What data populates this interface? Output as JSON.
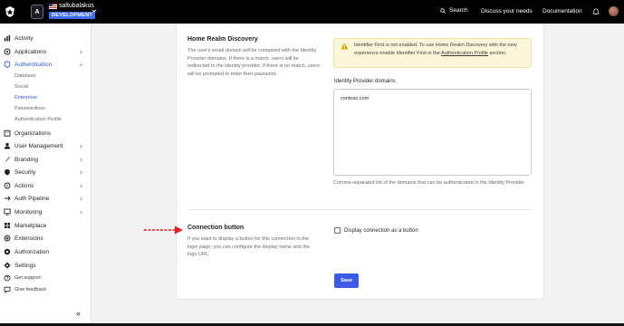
{
  "topbar": {
    "tenant_initial": "A",
    "tenant_name": "saltubalakus",
    "env_badge": "DEVELOPMENT",
    "search_label": "Search",
    "discuss_label": "Discuss your needs",
    "docs_label": "Documentation"
  },
  "sidebar": {
    "items": [
      {
        "label": "Activity",
        "icon": "activity-icon"
      },
      {
        "label": "Applications",
        "icon": "applications-icon"
      },
      {
        "label": "Authentication",
        "icon": "authentication-icon"
      },
      {
        "label": "Organizations",
        "icon": "organizations-icon"
      },
      {
        "label": "User Management",
        "icon": "user-management-icon"
      },
      {
        "label": "Branding",
        "icon": "branding-icon"
      },
      {
        "label": "Security",
        "icon": "security-icon"
      },
      {
        "label": "Actions",
        "icon": "actions-icon"
      },
      {
        "label": "Auth Pipeline",
        "icon": "auth-pipeline-icon"
      },
      {
        "label": "Monitoring",
        "icon": "monitoring-icon"
      },
      {
        "label": "Marketplace",
        "icon": "marketplace-icon"
      },
      {
        "label": "Extensions",
        "icon": "extensions-icon"
      },
      {
        "label": "Authorization",
        "icon": "authorization-icon"
      },
      {
        "label": "Settings",
        "icon": "settings-icon"
      },
      {
        "label": "Get support",
        "icon": "support-icon"
      },
      {
        "label": "Give feedback",
        "icon": "feedback-icon"
      }
    ],
    "auth_sub": [
      "Database",
      "Social",
      "Enterprise",
      "Passwordless",
      "Authentication Profile"
    ],
    "collapse_label": "«"
  },
  "home_realm": {
    "title": "Home Realm Discovery",
    "description": "The user's email domain will be compared with the Identity Provider domains. If there is a match, users will be redirected to the identity provider. If there is no match, users will be prompted to enter their password.",
    "alert_text": "Identifier First is not enabled. To use Home Realm Discovery with the new experience enable Identifier First in the",
    "alert_link": "Authentication Profile",
    "alert_suffix": "section.",
    "domains_label": "Identity Provider domains",
    "domains_value": "contoso.com",
    "domains_help": "Comma-separated list of the domains that can be authenticated in the Identity Provider."
  },
  "connection_button": {
    "title": "Connection button",
    "description": "If you want to display a button for this connection in the login page, you can configure the display name and the logo URL.",
    "checkbox_label": "Display connection as a button"
  },
  "actions": {
    "save_label": "Save"
  },
  "colors": {
    "accent": "#3e5ae8",
    "env_badge": "#3b6ef6",
    "alert_bg": "#fdf7da",
    "arrow": "#e02020"
  }
}
